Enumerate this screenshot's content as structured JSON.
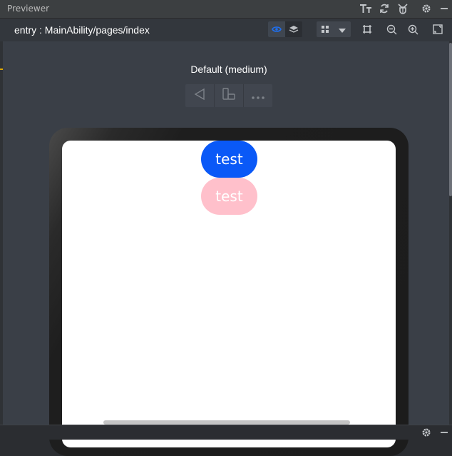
{
  "window": {
    "title": "Previewer"
  },
  "toolbar": {
    "path": "entry : MainAbility/pages/index"
  },
  "device": {
    "label": "Default (medium)"
  },
  "app": {
    "buttons": [
      {
        "label": "test",
        "color": "#0a59f7"
      },
      {
        "label": "test",
        "color": "#ffc0cb"
      }
    ]
  },
  "icons": {
    "titlebar": [
      "font-size-icon",
      "refresh-icon",
      "debug-icon",
      "gear-icon",
      "minimize-icon"
    ],
    "toolbar": [
      "eye-icon",
      "layers-icon",
      "grid-icon",
      "chevron-down-icon",
      "crop-icon",
      "zoom-out-icon",
      "zoom-in-icon",
      "fit-screen-icon"
    ],
    "device_controls": [
      "back-icon",
      "rotate-icon",
      "more-icon"
    ]
  },
  "colors": {
    "accent": "#1e6ff0",
    "background": "#3a3f47"
  }
}
